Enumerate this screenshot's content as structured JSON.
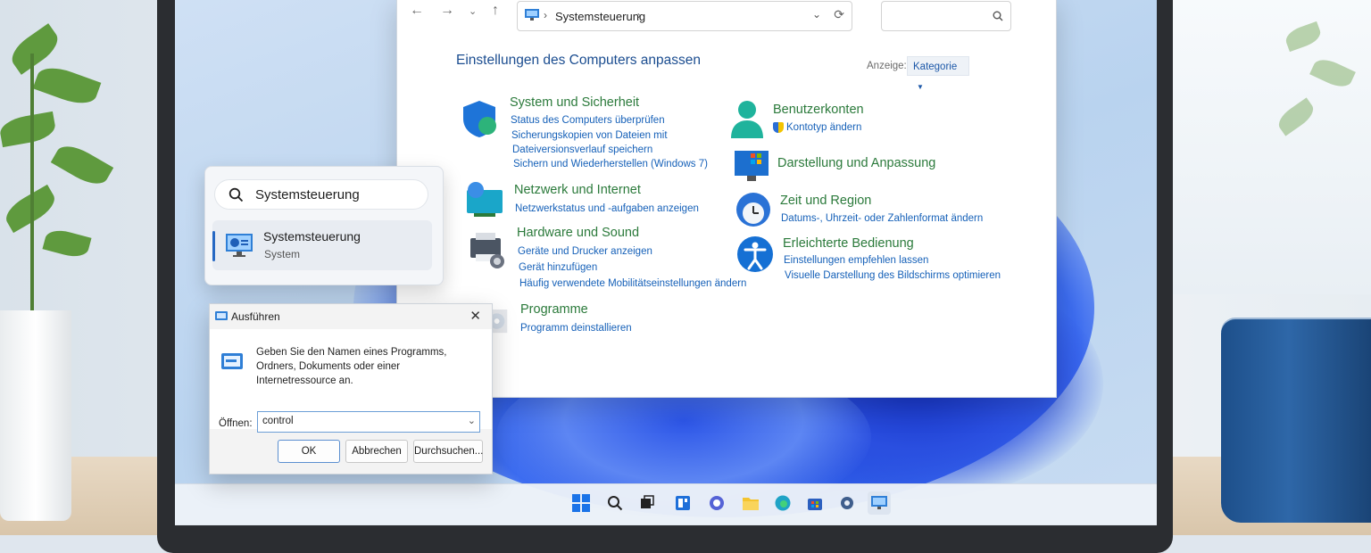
{
  "control_panel": {
    "address_path": "Systemsteuerung",
    "heading": "Einstellungen des Computers anpassen",
    "view_label": "Anzeige:",
    "view_value": "Kategorie",
    "categories": [
      {
        "title": "System und Sicherheit",
        "links": [
          "Status des Computers überprüfen",
          "Sicherungskopien von Dateien mit",
          "Dateiversionsverlauf speichern",
          "Sichern und Wiederherstellen (Windows 7)"
        ]
      },
      {
        "title": "Netzwerk und Internet",
        "links": [
          "Netzwerkstatus und -aufgaben anzeigen"
        ]
      },
      {
        "title": "Hardware und Sound",
        "links": [
          "Geräte und Drucker anzeigen",
          "Gerät hinzufügen",
          "Häufig verwendete Mobilitätseinstellungen ändern"
        ]
      },
      {
        "title": "Programme",
        "links": [
          "Programm deinstallieren"
        ]
      },
      {
        "title": "Benutzerkonten",
        "links": [
          "Kontotyp ändern"
        ]
      },
      {
        "title": "Darstellung und Anpassung",
        "links": []
      },
      {
        "title": "Zeit und Region",
        "links": [
          "Datums-, Uhrzeit- oder Zahlenformat ändern"
        ]
      },
      {
        "title": "Erleichterte Bedienung",
        "links": [
          "Einstellungen empfehlen lassen",
          "Visuelle Darstellung des Bildschirms optimieren"
        ]
      }
    ]
  },
  "search_popup": {
    "query": "Systemsteuerung",
    "result_title": "Systemsteuerung",
    "result_subtitle": "System"
  },
  "run_dialog": {
    "title": "Ausführen",
    "description": "Geben Sie den Namen eines Programms, Ordners, Dokuments oder einer Internetressource an.",
    "open_label": "Öffnen:",
    "open_value": "control",
    "ok": "OK",
    "cancel": "Abbrechen",
    "browse": "Durchsuchen..."
  },
  "colors": {
    "accent": "#2668c3",
    "link": "#1560b8",
    "category_title": "#2b7a3b",
    "heading": "#1b4d90"
  }
}
